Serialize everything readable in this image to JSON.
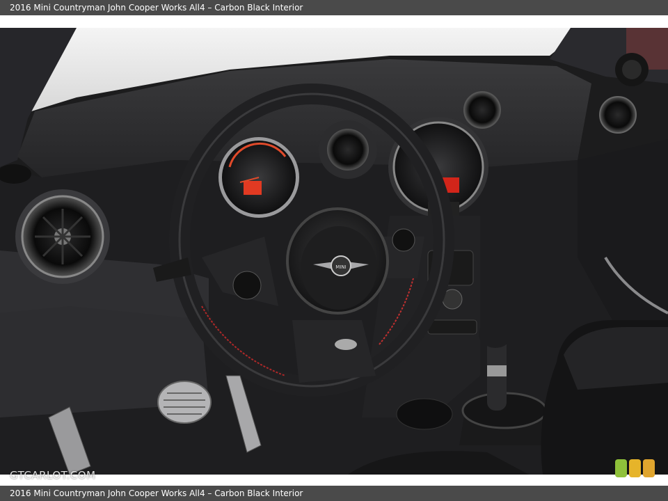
{
  "caption": {
    "top": "2016 Mini Countryman John Cooper Works All4 – Carbon Black Interior",
    "bottom": "2016 Mini Countryman John Cooper Works All4 – Carbon Black Interior"
  },
  "photo": {
    "subject": "car-interior",
    "badge_text": "MINI"
  },
  "watermark": {
    "text": "GTCARLOT.COM"
  },
  "rating_colors": [
    "#8fc13a",
    "#e6b42a",
    "#e0a52e"
  ]
}
